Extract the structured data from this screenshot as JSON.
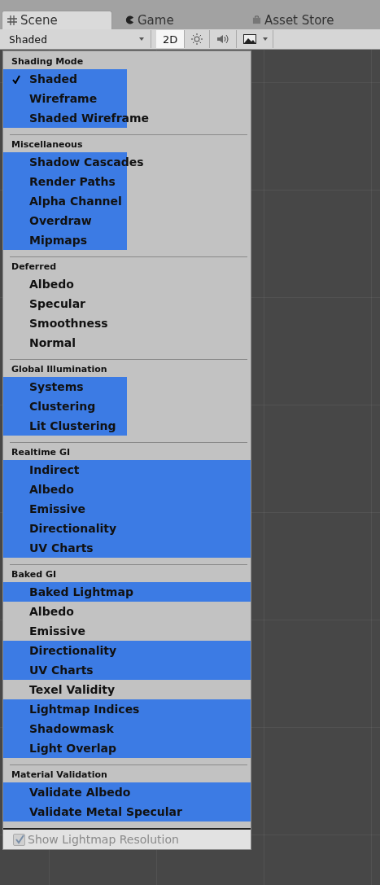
{
  "tabs": [
    {
      "label": "Scene",
      "kind": "grid",
      "selected": true
    },
    {
      "label": "Game",
      "kind": "pacman",
      "selected": false
    },
    {
      "label": "Asset Store",
      "kind": "bag",
      "selected": false
    }
  ],
  "toolbar": {
    "draw_mode": "Shaded",
    "mode_2d": {
      "label": "2D",
      "on": true
    }
  },
  "menu": {
    "sections": [
      {
        "title": "Shading Mode",
        "items": [
          {
            "label": "Shaded",
            "checked": true,
            "kind": "half"
          },
          {
            "label": "Wireframe",
            "checked": false,
            "kind": "half"
          },
          {
            "label": "Shaded Wireframe",
            "checked": false,
            "kind": "half"
          }
        ]
      },
      {
        "title": "Miscellaneous",
        "items": [
          {
            "label": "Shadow Cascades",
            "checked": false,
            "kind": "half"
          },
          {
            "label": "Render Paths",
            "checked": false,
            "kind": "half"
          },
          {
            "label": "Alpha Channel",
            "checked": false,
            "kind": "half"
          },
          {
            "label": "Overdraw",
            "checked": false,
            "kind": "half"
          },
          {
            "label": "Mipmaps",
            "checked": false,
            "kind": "half"
          }
        ]
      },
      {
        "title": "Deferred",
        "items": [
          {
            "label": "Albedo",
            "checked": false,
            "kind": "plain"
          },
          {
            "label": "Specular",
            "checked": false,
            "kind": "plain"
          },
          {
            "label": "Smoothness",
            "checked": false,
            "kind": "plain"
          },
          {
            "label": "Normal",
            "checked": false,
            "kind": "plain"
          }
        ]
      },
      {
        "title": "Global Illumination",
        "items": [
          {
            "label": "Systems",
            "checked": false,
            "kind": "half"
          },
          {
            "label": "Clustering",
            "checked": false,
            "kind": "half"
          },
          {
            "label": "Lit Clustering",
            "checked": false,
            "kind": "half"
          }
        ]
      },
      {
        "title": "Realtime GI",
        "items": [
          {
            "label": "Indirect",
            "checked": false,
            "kind": "full"
          },
          {
            "label": "Albedo",
            "checked": false,
            "kind": "full"
          },
          {
            "label": "Emissive",
            "checked": false,
            "kind": "full"
          },
          {
            "label": "Directionality",
            "checked": false,
            "kind": "full"
          },
          {
            "label": "UV Charts",
            "checked": false,
            "kind": "full"
          }
        ]
      },
      {
        "title": "Baked GI",
        "items": [
          {
            "label": "Baked Lightmap",
            "checked": false,
            "kind": "full"
          },
          {
            "label": "Albedo",
            "checked": false,
            "kind": "plain"
          },
          {
            "label": "Emissive",
            "checked": false,
            "kind": "plain"
          },
          {
            "label": "Directionality",
            "checked": false,
            "kind": "full"
          },
          {
            "label": "UV Charts",
            "checked": false,
            "kind": "full"
          },
          {
            "label": "Texel Validity",
            "checked": false,
            "kind": "plain"
          },
          {
            "label": "Lightmap Indices",
            "checked": false,
            "kind": "full"
          },
          {
            "label": "Shadowmask",
            "checked": false,
            "kind": "full"
          },
          {
            "label": "Light Overlap",
            "checked": false,
            "kind": "full"
          }
        ]
      },
      {
        "title": "Material Validation",
        "items": [
          {
            "label": "Validate Albedo",
            "checked": false,
            "kind": "full"
          },
          {
            "label": "Validate Metal Specular",
            "checked": false,
            "kind": "full"
          }
        ]
      }
    ],
    "footer": {
      "label": "Show Lightmap Resolution",
      "checked": true,
      "disabled": true
    }
  }
}
